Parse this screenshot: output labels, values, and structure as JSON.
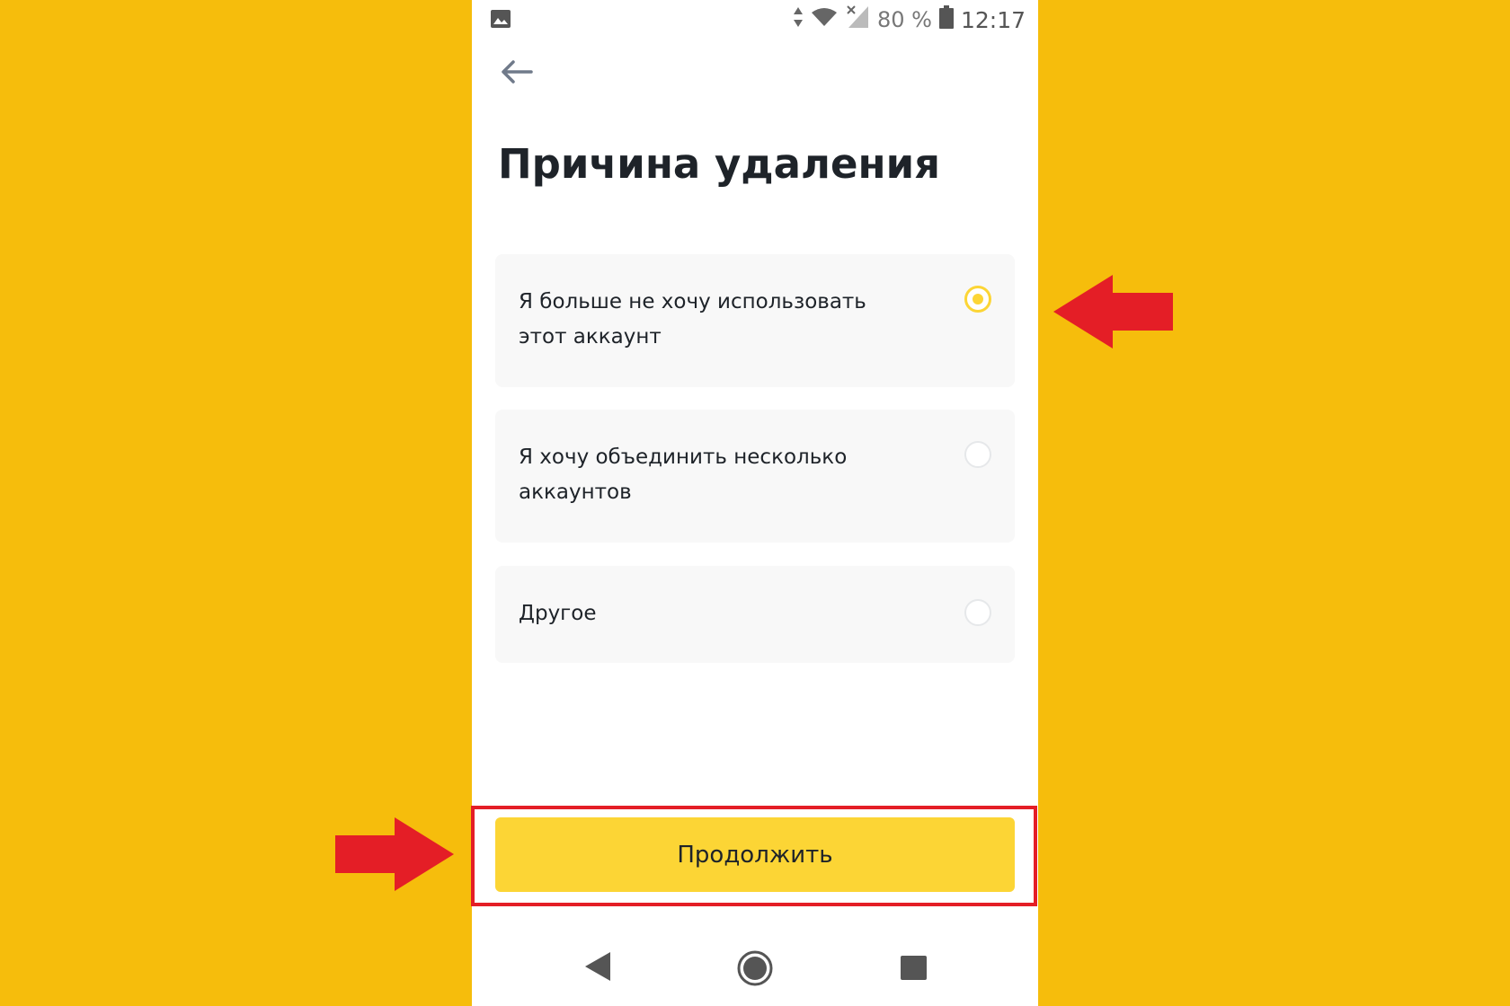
{
  "status_bar": {
    "battery_text": "80 %",
    "time": "12:17"
  },
  "page": {
    "title": "Причина удаления"
  },
  "options": [
    {
      "label": "Я больше не хочу использовать этот аккаунт",
      "selected": true
    },
    {
      "label": "Я хочу объединить несколько аккаунтов",
      "selected": false
    },
    {
      "label": "Другое",
      "selected": false
    }
  ],
  "continue_button": {
    "label": "Продолжить"
  },
  "colors": {
    "background": "#F6BD0C",
    "accent": "#FCD535",
    "annotation": "#E41E26",
    "text": "#1E2329"
  },
  "icons": [
    "image-icon",
    "data-arrows-icon",
    "wifi-icon",
    "no-signal-icon",
    "battery-icon",
    "back-arrow-icon",
    "nav-back-icon",
    "nav-home-icon",
    "nav-recent-icon"
  ]
}
